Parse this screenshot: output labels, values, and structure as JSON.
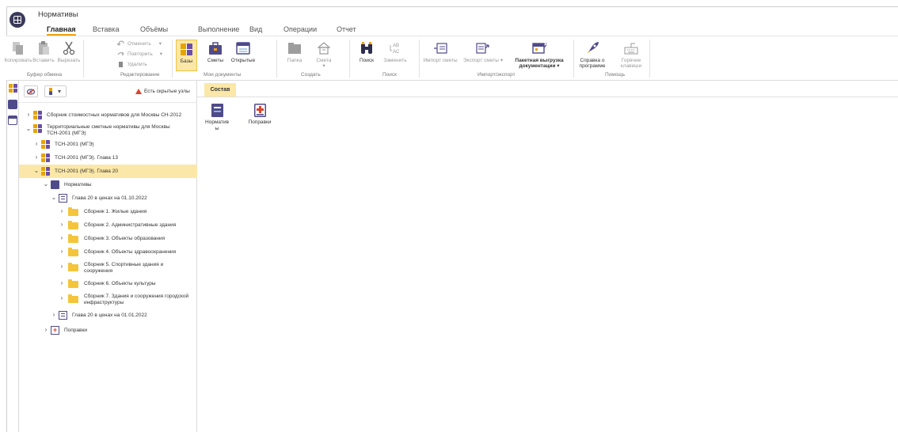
{
  "window": {
    "title": "Нормативы"
  },
  "tabs": [
    "Главная",
    "Вставка",
    "Объёмы",
    "Выполнение",
    "Вид",
    "Операции",
    "Отчет"
  ],
  "ribbon": {
    "clipboard": {
      "copy": "Копировать",
      "paste": "Вставить",
      "cut": "Вырезать",
      "group": "Буфер обмена"
    },
    "edit": {
      "undo": "Отменить",
      "redo": "Повторить",
      "delete": "Удалить",
      "group": "Редактирование"
    },
    "mydocs": {
      "bases": "Базы",
      "estimates": "Сметы",
      "opened": "Открытые",
      "group": "Мои документы"
    },
    "create": {
      "folder": "Папка",
      "estimate": "Смета",
      "group": "Создать"
    },
    "search": {
      "search": "Поиск",
      "replace": "Заменить",
      "group": "Поиск"
    },
    "importexport": {
      "import": "Импорт сметы",
      "export": "Экспорт сметы",
      "batch": "Пакетная выгрузка документации",
      "group": "Импорт/экспорт"
    },
    "help": {
      "about": "Справка о программе",
      "hotkeys": "Горячие клавиши",
      "group": "Помощь"
    }
  },
  "tree": {
    "hidden_nodes": "Есть скрытые узлы",
    "nodes": [
      "Сборник стоимостных нормативов для Москвы СН-2012",
      "Территориальные сметные нормативы для Москвы ТСН-2001 (МГЭ)",
      "ТСН-2001 (МГЭ)",
      "ТСН-2001 (МГЭ). Глава 13",
      "ТСН-2001 (МГЭ). Глава 20",
      "Нормативы",
      "Глава 20 в ценах на 01.10.2022",
      "Сборник 1. Жилые здания",
      "Сборник 2. Административные здания",
      "Сборник 3. Объекты образования",
      "Сборник 4. Объекты здравоохранения",
      "Сборник 5. Спортивные здания и сооружения",
      "Сборник 6. Объекты культуры",
      "Сборник 7. Здания и сооружения городской инфраструктуры",
      "Глава 20 в ценах на 01.01.2022",
      "Поправки"
    ]
  },
  "content": {
    "tab": "Состав",
    "items": [
      "Нормативы",
      "Поправки"
    ]
  },
  "colors": {
    "accent": "#f0a30a",
    "selected": "#fbe7a7",
    "folder": "#f4c53a",
    "brand": "#4f4b8a"
  }
}
